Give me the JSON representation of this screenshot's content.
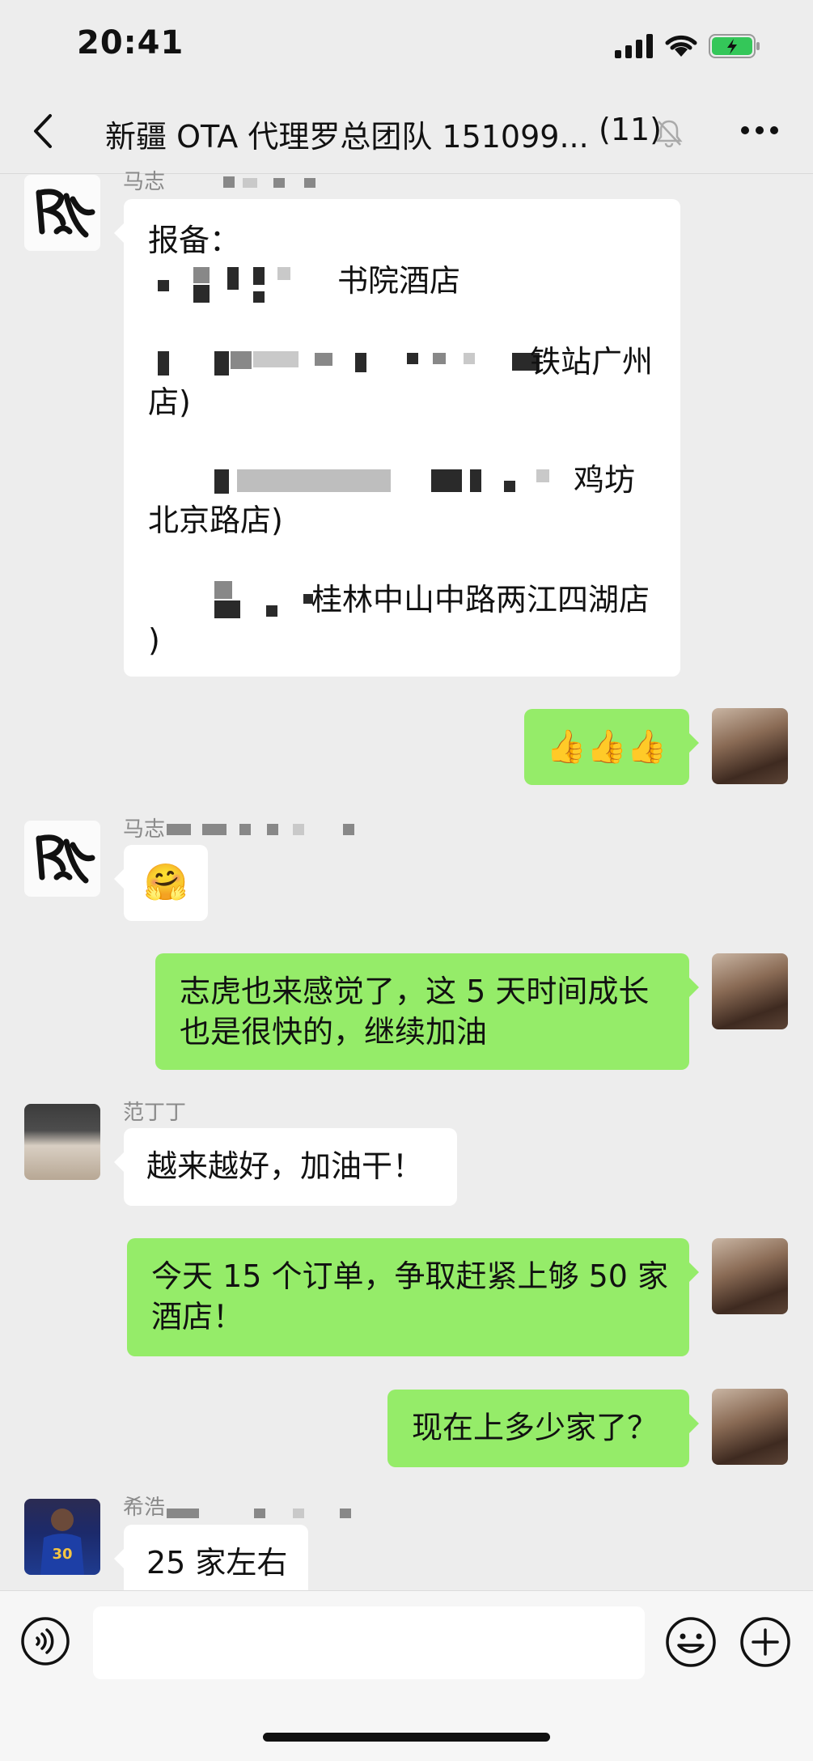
{
  "status_bar": {
    "time": "20:41"
  },
  "header": {
    "title": "新疆 OTA 代理罗总团队 151099...",
    "member_count": "(11)"
  },
  "messages": {
    "m1": {
      "sender": "马志",
      "line1": "报备：",
      "line2": "书院酒店",
      "line3": "铁站广州",
      "line4": "店)",
      "line5": "鸡坊",
      "line6": "北京路店)",
      "line7": "桂林中山中路两江四湖店",
      "line8": ")"
    },
    "m2": {
      "text": "👍👍👍"
    },
    "m3": {
      "sender": "马志",
      "text": "🤗"
    },
    "m4": {
      "line1": "志虎也来感觉了，这 5 天时间成长",
      "line2": "也是很快的，继续加油"
    },
    "m5": {
      "sender": "范丁丁",
      "text": "越来越好，加油干！"
    },
    "m6": {
      "line1": "今天 15 个订单，争取赶紧上够 50 家",
      "line2": "酒店！"
    },
    "m7": {
      "text": "现在上多少家了？"
    },
    "m8": {
      "sender": "希浩",
      "text": "25 家左右"
    }
  },
  "avatars": {
    "player_number": "30"
  },
  "colors": {
    "outgoing_bubble": "#95ec69",
    "incoming_bubble": "#ffffff",
    "background": "#ededed"
  }
}
